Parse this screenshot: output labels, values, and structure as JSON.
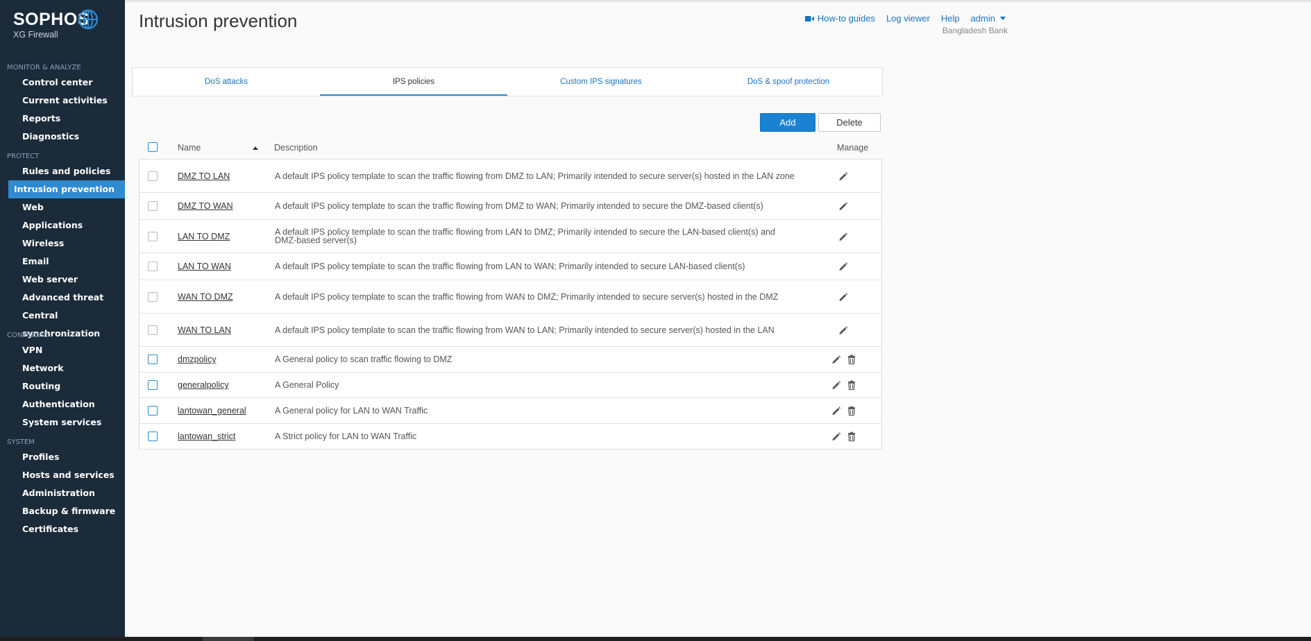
{
  "brand": {
    "name": "SOPHOS",
    "product": "XG Firewall"
  },
  "sidebar": {
    "sections": [
      {
        "title": "MONITOR & ANALYZE",
        "items": [
          "Control center",
          "Current activities",
          "Reports",
          "Diagnostics"
        ]
      },
      {
        "title": "PROTECT",
        "items": [
          "Rules and policies",
          "Intrusion prevention",
          "Web",
          "Applications",
          "Wireless",
          "Email",
          "Web server",
          "Advanced threat",
          "Central synchronization"
        ]
      },
      {
        "title": "CONFIGURE",
        "items": [
          "VPN",
          "Network",
          "Routing",
          "Authentication",
          "System services"
        ]
      },
      {
        "title": "SYSTEM",
        "items": [
          "Profiles",
          "Hosts and services",
          "Administration",
          "Backup & firmware",
          "Certificates"
        ]
      }
    ],
    "active": "Intrusion prevention"
  },
  "header": {
    "title": "Intrusion prevention",
    "links": {
      "howto": "How-to guides",
      "log": "Log viewer",
      "help": "Help",
      "user": "admin"
    },
    "org": "Bangladesh Bank"
  },
  "tabs": [
    "DoS attacks",
    "IPS policies",
    "Custom IPS signatures",
    "DoS & spoof protection"
  ],
  "active_tab": "IPS policies",
  "toolbar": {
    "add_label": "Add",
    "delete_label": "Delete"
  },
  "table": {
    "columns": {
      "name": "Name",
      "description": "Description",
      "manage": "Manage"
    },
    "rows": [
      {
        "name": "DMZ TO LAN",
        "description": "A default IPS policy template to scan the traffic flowing from DMZ to LAN; Primarily intended to secure server(s) hosted in the LAN zone",
        "default": true
      },
      {
        "name": "DMZ TO WAN",
        "description": "A default IPS policy template to scan the traffic flowing from DMZ to WAN; Primarily intended to secure the DMZ-based client(s)",
        "default": true
      },
      {
        "name": "LAN TO DMZ",
        "description": "A default IPS policy template to scan the traffic flowing from LAN to DMZ; Primarily intended to secure the LAN-based client(s) and DMZ-based server(s)",
        "default": true
      },
      {
        "name": "LAN TO WAN",
        "description": "A default IPS policy template to scan the traffic flowing from LAN to WAN; Primarily intended to secure LAN-based client(s)",
        "default": true
      },
      {
        "name": "WAN TO DMZ",
        "description": "A default IPS policy template to scan the traffic flowing from WAN to DMZ; Primarily intended to secure server(s) hosted in the DMZ",
        "default": true
      },
      {
        "name": "WAN TO LAN",
        "description": "A default IPS policy template to scan the traffic flowing from WAN to LAN; Primarily intended to secure server(s) hosted in the LAN",
        "default": true
      },
      {
        "name": "dmzpolicy",
        "description": "A General policy to scan traffic flowing to DMZ",
        "default": false
      },
      {
        "name": "generalpolicy",
        "description": "A General Policy",
        "default": false
      },
      {
        "name": "lantowan_general",
        "description": "A General policy for LAN to WAN Traffic",
        "default": false
      },
      {
        "name": "lantowan_strict",
        "description": "A Strict policy for LAN to WAN Traffic",
        "default": false
      }
    ]
  },
  "icons": {
    "edit": "pencil-icon",
    "delete": "trash-icon",
    "video": "video-camera-icon",
    "globe": "globe-icon"
  },
  "colors": {
    "sidebar_bg": "#1b2b3a",
    "accent": "#2f8ad0",
    "link": "#1a74c2"
  }
}
